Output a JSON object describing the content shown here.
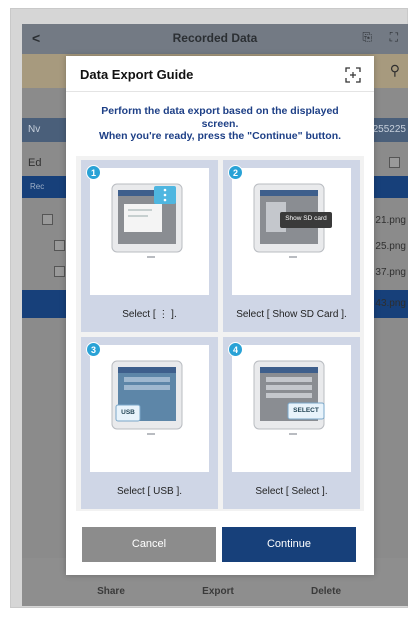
{
  "background": {
    "header_title": "Recorded Data",
    "back_glyph": "<",
    "bluebar_left": "Nv",
    "bluebar_right": "255225",
    "row_edit": "Ed",
    "row_rec": "Rec",
    "files": [
      "21.png",
      "25.png",
      "37.png",
      "43.png"
    ],
    "tabs": [
      "Share",
      "Export",
      "Delete"
    ]
  },
  "dialog": {
    "title": "Data Export Guide",
    "instruction_line1": "Perform the data export based on the displayed",
    "instruction_line2": "screen.",
    "instruction_line3": "When you're ready, press the \"Continue\" button.",
    "steps": [
      {
        "number": "1",
        "caption": "Select [ ⋮ ]."
      },
      {
        "number": "2",
        "caption": "Select [ Show SD Card ].",
        "callout": "Show SD card"
      },
      {
        "number": "3",
        "caption": "Select [ USB ].",
        "callout": "USB"
      },
      {
        "number": "4",
        "caption": "Select [ Select ].",
        "callout": "SELECT"
      }
    ],
    "cancel_label": "Cancel",
    "continue_label": "Continue"
  },
  "colors": {
    "accent_navy": "#17407a",
    "badge_blue": "#29a2d6",
    "instruction_blue": "#1d3f86"
  }
}
